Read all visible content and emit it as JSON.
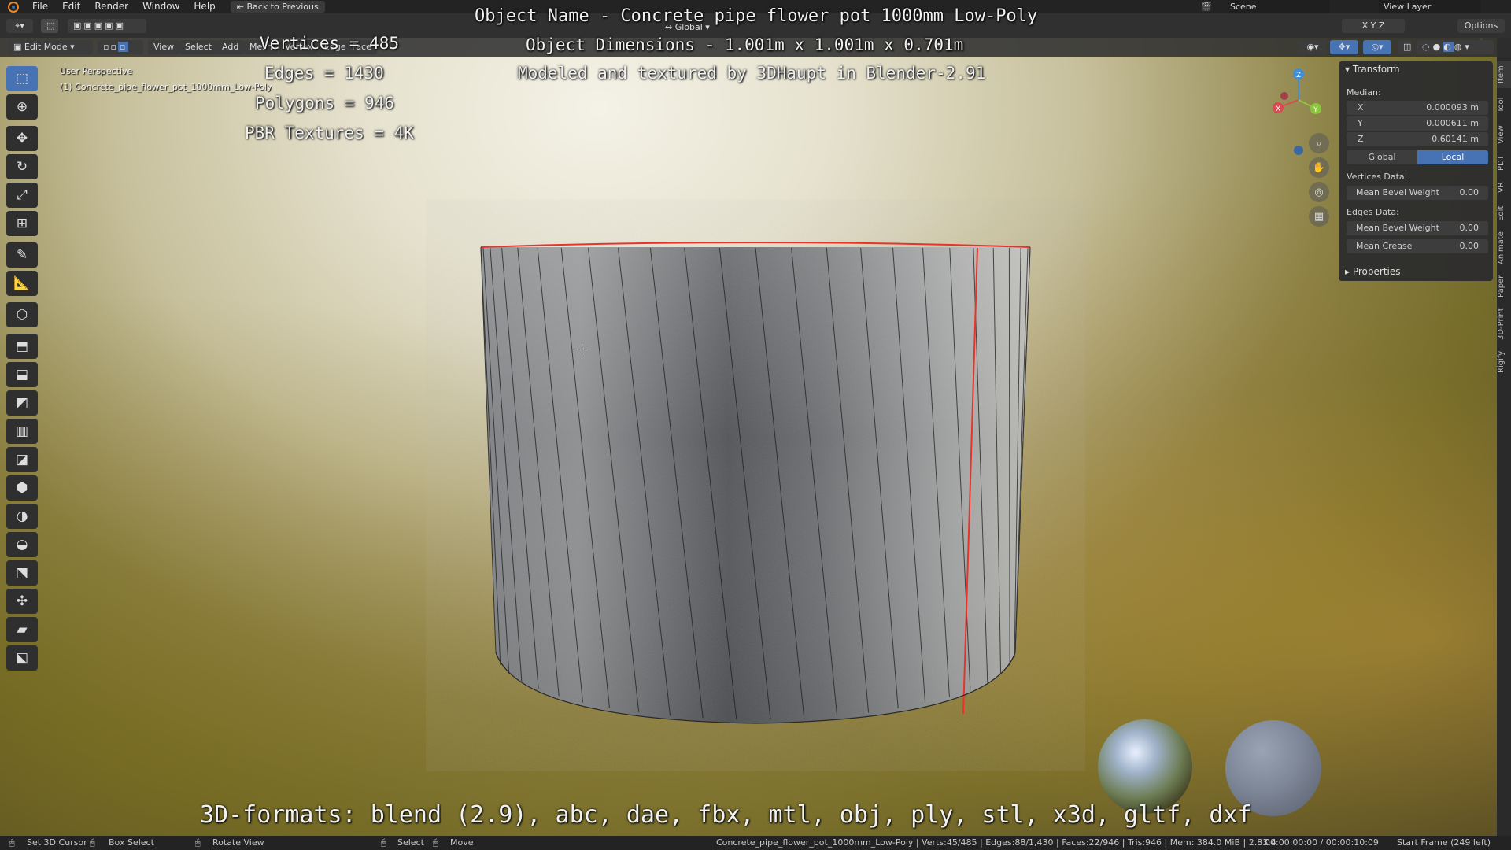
{
  "menu": {
    "items": [
      "File",
      "Edit",
      "Render",
      "Window",
      "Help"
    ],
    "back_button": "Back to Previous",
    "scene": "Scene",
    "view_layer": "View Layer"
  },
  "header": {
    "mode": "Edit Mode",
    "menus": [
      "View",
      "Select",
      "Add",
      "Mesh",
      "Vertex",
      "Edge",
      "Face",
      "UV"
    ],
    "transform_orientation": "Global",
    "axes": [
      "X",
      "Y",
      "Z"
    ],
    "options_label": "Options"
  },
  "viewport": {
    "perspective_label": "User Perspective",
    "object_label": "(1) Concrete_pipe_flower_pot_1000mm_Low-Poly"
  },
  "overlay": {
    "vertices": "Vertices = 485",
    "edges": "Edges = 1430",
    "polygons": "Polygons = 946",
    "textures": "PBR Textures = 4K",
    "object_name": "Object Name - Concrete pipe flower pot 1000mm Low-Poly",
    "dimensions": "Object Dimensions -  1.001m x 1.001m x 0.701m",
    "credit": "Modeled and textured by 3DHaupt in Blender-2.91",
    "formats": "3D-formats: blend (2.9), abc, dae, fbx, mtl, obj, ply, stl, x3d, gltf, dxf"
  },
  "gizmo": {
    "x": "X",
    "y": "Y",
    "z": "Z"
  },
  "transform_panel": {
    "title": "Transform",
    "median_label": "Median:",
    "x_label": "X",
    "x_value": "0.000093 m",
    "y_label": "Y",
    "y_value": "0.000611 m",
    "z_label": "Z",
    "z_value": "0.60141 m",
    "global_label": "Global",
    "local_label": "Local",
    "vertices_data_label": "Vertices Data:",
    "v_mean_bevel_label": "Mean Bevel Weight",
    "v_mean_bevel_value": "0.00",
    "edges_data_label": "Edges Data:",
    "e_mean_bevel_label": "Mean Bevel Weight",
    "e_mean_bevel_value": "0.00",
    "mean_crease_label": "Mean Crease",
    "mean_crease_value": "0.00",
    "properties_label": "Properties"
  },
  "side_tabs": [
    "Item",
    "Tool",
    "View",
    "PDT",
    "VR",
    "Edit",
    "Animate",
    "Paper",
    "3D-Print",
    "Rigify"
  ],
  "status": {
    "hint1": "Set 3D Cursor",
    "hint2": "Box Select",
    "hint3": "Rotate View",
    "hint4": "Select",
    "hint5": "Move",
    "stats": "Concrete_pipe_flower_pot_1000mm_Low-Poly | Verts:45/485 | Edges:88/1,430 | Faces:22/946 | Tris:946 | Mem: 384.0 MiB | 2.83.4",
    "time": "00:00:00:00 / 00:00:10:09",
    "frame": "Start Frame (249 left)"
  },
  "colors": {
    "accent": "#4772b3",
    "selected_edge": "#e8332b",
    "x_axis": "#d94a52",
    "y_axis": "#8cc63f",
    "z_axis": "#3f8ed9"
  }
}
